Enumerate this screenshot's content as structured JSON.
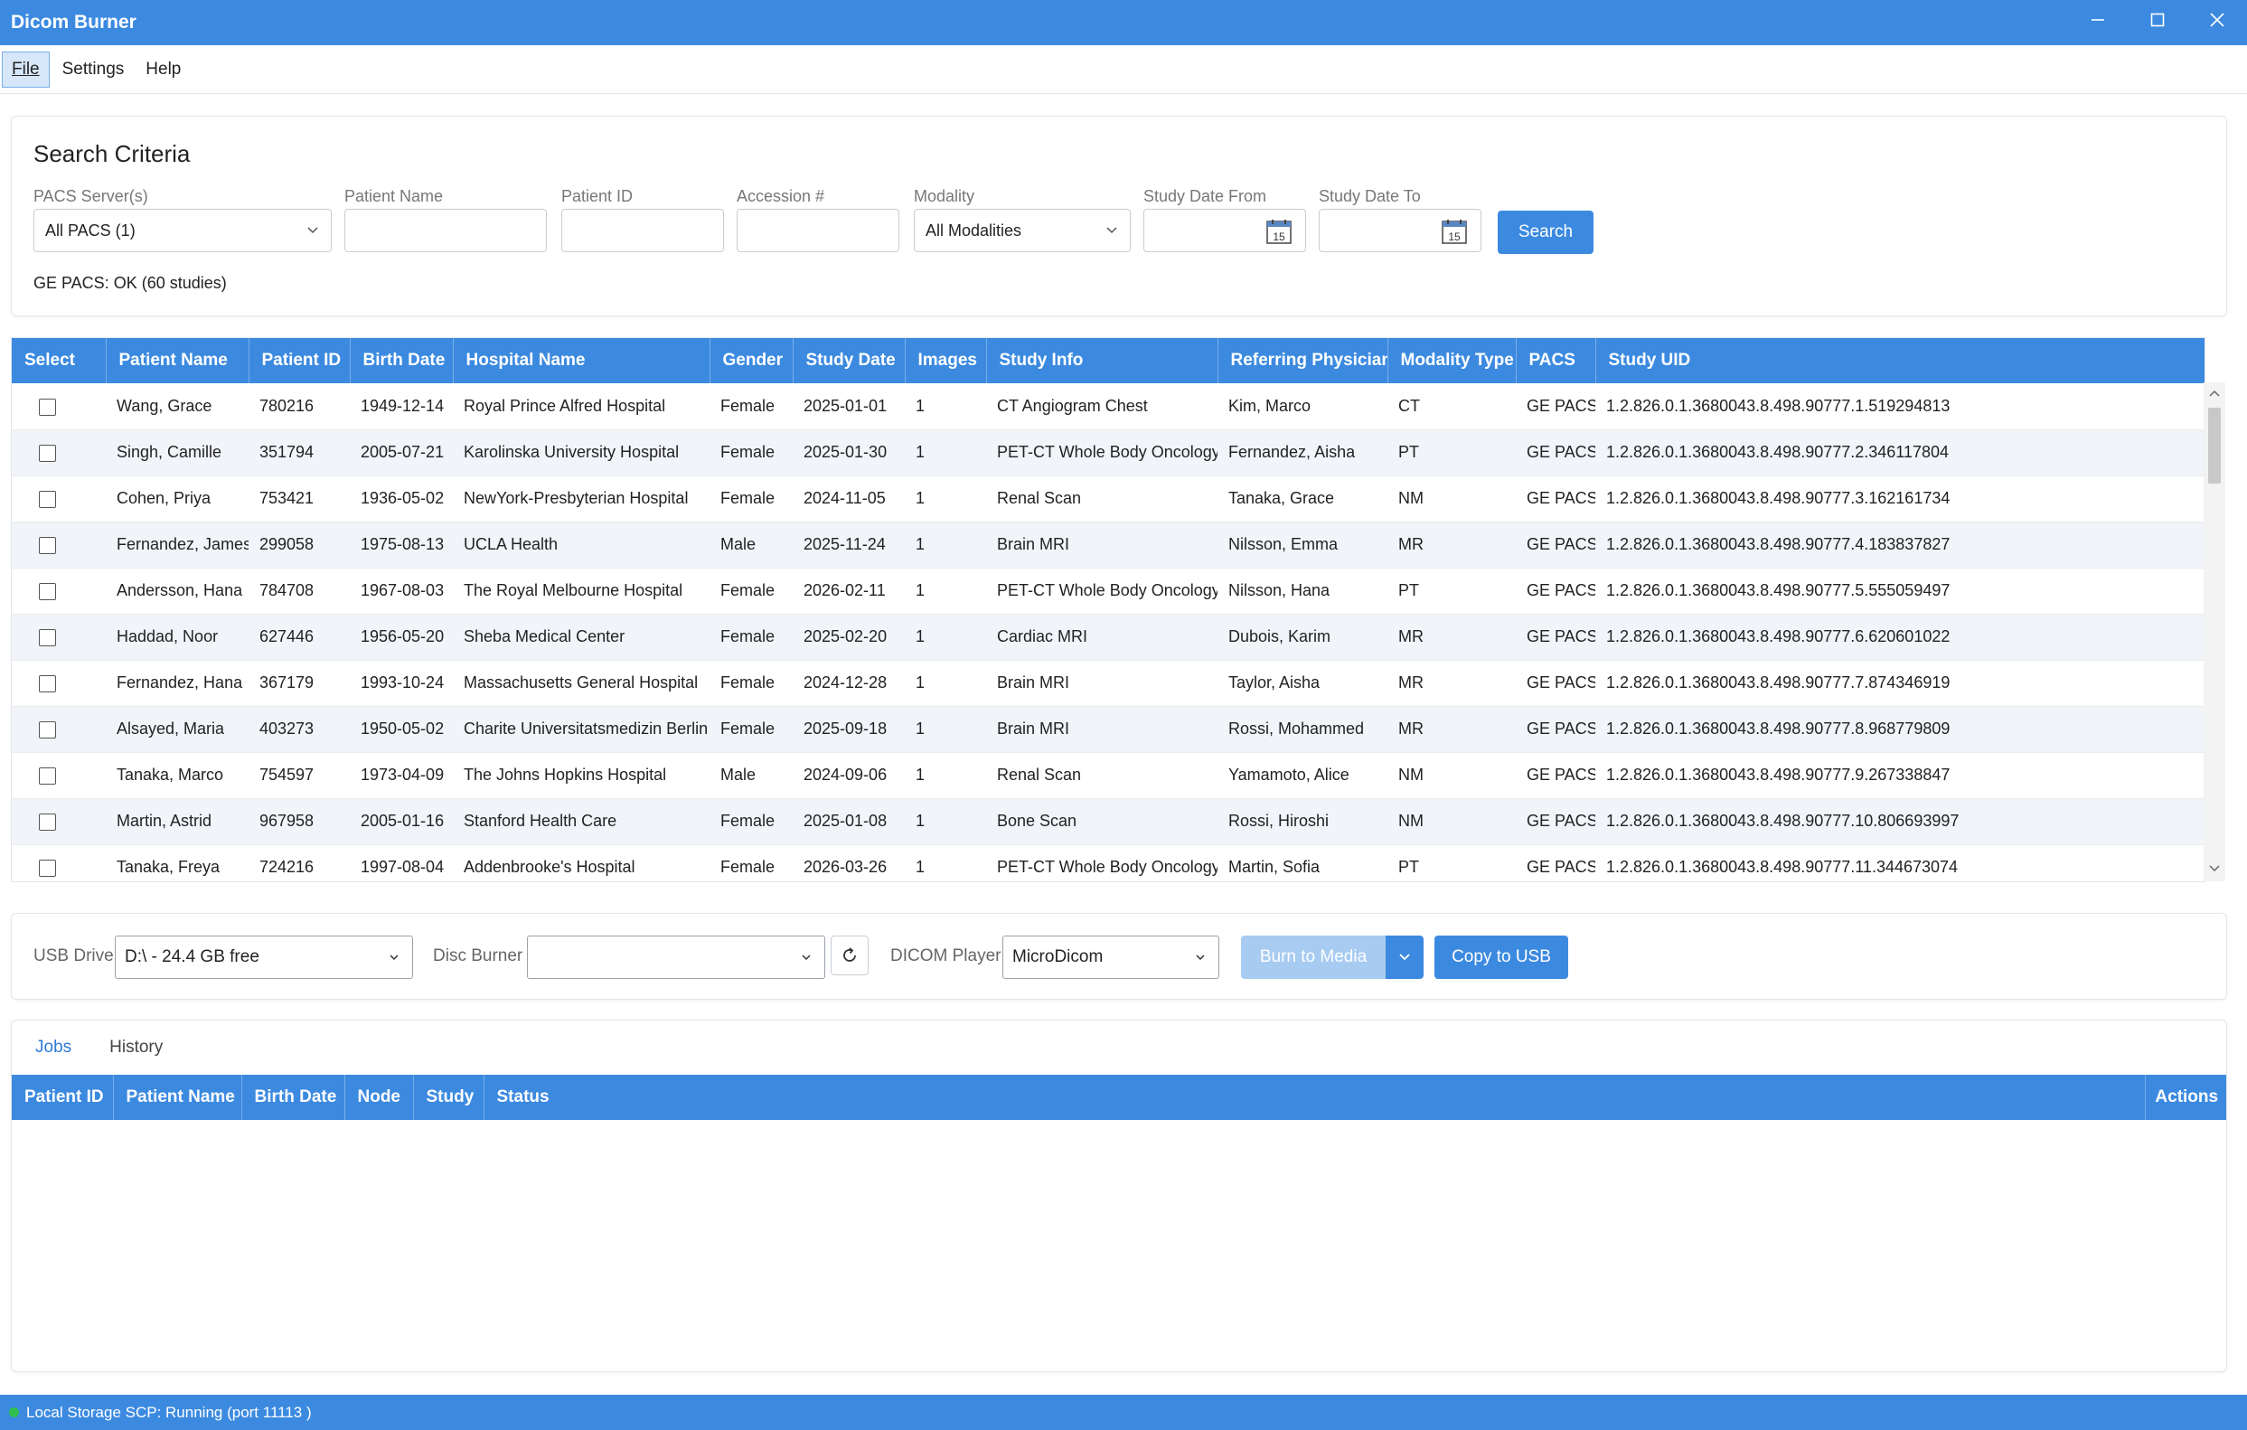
{
  "window": {
    "title": "Dicom Burner"
  },
  "menu": {
    "file": "File",
    "settings": "Settings",
    "help": "Help"
  },
  "search": {
    "heading": "Search Criteria",
    "pacs_label": "PACS Server(s)",
    "pacs_value": "All PACS (1)",
    "patient_name_label": "Patient Name",
    "patient_name_value": "",
    "patient_id_label": "Patient ID",
    "patient_id_value": "",
    "accession_label": "Accession #",
    "accession_value": "",
    "modality_label": "Modality",
    "modality_value": "All Modalities",
    "date_from_label": "Study Date From",
    "date_from_value": "",
    "date_to_label": "Study Date To",
    "date_to_value": "",
    "calendar_day": "15",
    "search_button": "Search",
    "status": "GE PACS: OK (60 studies)"
  },
  "studies": {
    "columns": [
      "Select",
      "Patient Name",
      "Patient ID",
      "Birth Date",
      "Hospital Name",
      "Gender",
      "Study Date",
      "Images",
      "Study Info",
      "Referring Physician",
      "Modality Type",
      "PACS",
      "Study UID"
    ],
    "rows": [
      [
        "Wang, Grace",
        "780216",
        "1949-12-14",
        "Royal Prince Alfred Hospital",
        "Female",
        "2025-01-01",
        "1",
        "CT Angiogram Chest",
        "Kim, Marco",
        "CT",
        "GE PACS",
        "1.2.826.0.1.3680043.8.498.90777.1.519294813"
      ],
      [
        "Singh, Camille",
        "351794",
        "2005-07-21",
        "Karolinska University Hospital",
        "Female",
        "2025-01-30",
        "1",
        "PET-CT Whole Body Oncology",
        "Fernandez, Aisha",
        "PT",
        "GE PACS",
        "1.2.826.0.1.3680043.8.498.90777.2.346117804"
      ],
      [
        "Cohen, Priya",
        "753421",
        "1936-05-02",
        "NewYork-Presbyterian Hospital",
        "Female",
        "2024-11-05",
        "1",
        "Renal Scan",
        "Tanaka, Grace",
        "NM",
        "GE PACS",
        "1.2.826.0.1.3680043.8.498.90777.3.162161734"
      ],
      [
        "Fernandez, James",
        "299058",
        "1975-08-13",
        "UCLA Health",
        "Male",
        "2025-11-24",
        "1",
        "Brain MRI",
        "Nilsson, Emma",
        "MR",
        "GE PACS",
        "1.2.826.0.1.3680043.8.498.90777.4.183837827"
      ],
      [
        "Andersson, Hana",
        "784708",
        "1967-08-03",
        "The Royal Melbourne Hospital",
        "Female",
        "2026-02-11",
        "1",
        "PET-CT Whole Body Oncology",
        "Nilsson, Hana",
        "PT",
        "GE PACS",
        "1.2.826.0.1.3680043.8.498.90777.5.555059497"
      ],
      [
        "Haddad, Noor",
        "627446",
        "1956-05-20",
        "Sheba Medical Center",
        "Female",
        "2025-02-20",
        "1",
        "Cardiac MRI",
        "Dubois, Karim",
        "MR",
        "GE PACS",
        "1.2.826.0.1.3680043.8.498.90777.6.620601022"
      ],
      [
        "Fernandez, Hana",
        "367179",
        "1993-10-24",
        "Massachusetts General Hospital",
        "Female",
        "2024-12-28",
        "1",
        "Brain MRI",
        "Taylor, Aisha",
        "MR",
        "GE PACS",
        "1.2.826.0.1.3680043.8.498.90777.7.874346919"
      ],
      [
        "Alsayed, Maria",
        "403273",
        "1950-05-02",
        "Charite Universitatsmedizin Berlin",
        "Female",
        "2025-09-18",
        "1",
        "Brain MRI",
        "Rossi, Mohammed",
        "MR",
        "GE PACS",
        "1.2.826.0.1.3680043.8.498.90777.8.968779809"
      ],
      [
        "Tanaka, Marco",
        "754597",
        "1973-04-09",
        "The Johns Hopkins Hospital",
        "Male",
        "2024-09-06",
        "1",
        "Renal Scan",
        "Yamamoto, Alice",
        "NM",
        "GE PACS",
        "1.2.826.0.1.3680043.8.498.90777.9.267338847"
      ],
      [
        "Martin, Astrid",
        "967958",
        "2005-01-16",
        "Stanford Health Care",
        "Female",
        "2025-01-08",
        "1",
        "Bone Scan",
        "Rossi, Hiroshi",
        "NM",
        "GE PACS",
        "1.2.826.0.1.3680043.8.498.90777.10.806693997"
      ],
      [
        "Tanaka, Freya",
        "724216",
        "1997-08-04",
        "Addenbrooke's Hospital",
        "Female",
        "2026-03-26",
        "1",
        "PET-CT Whole Body Oncology",
        "Martin, Sofia",
        "PT",
        "GE PACS",
        "1.2.826.0.1.3680043.8.498.90777.11.344673074"
      ]
    ]
  },
  "burner": {
    "usb_label": "USB Drive",
    "usb_value": "D:\\ - 24.4 GB free",
    "disc_label": "Disc Burner",
    "disc_value": "",
    "player_label": "DICOM Player",
    "player_value": "MicroDicom",
    "burn_button": "Burn to Media",
    "copy_button": "Copy to USB"
  },
  "jobs": {
    "tabs": [
      "Jobs",
      "History"
    ],
    "columns": [
      "Patient ID",
      "Patient Name",
      "Birth Date",
      "Node",
      "Study",
      "Status"
    ],
    "actions_column": "Actions"
  },
  "statusbar": {
    "text": "Local Storage SCP: Running (port  11113 )"
  },
  "colors": {
    "accent": "#3c8ae0",
    "alt_row": "#f1f4f9",
    "status_ok": "#2fbf4f"
  }
}
